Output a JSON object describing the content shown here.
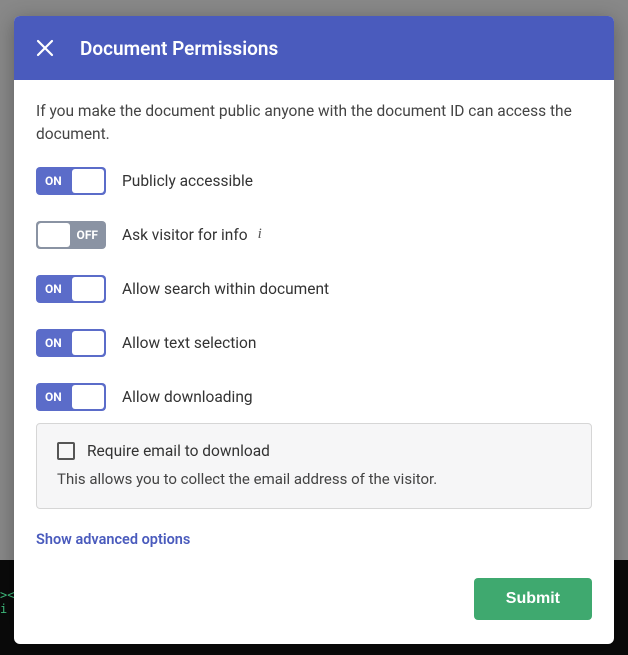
{
  "header": {
    "title": "Document Permissions"
  },
  "intro": "If you make the document public anyone with the document ID can access the document.",
  "toggles": {
    "on_text": "ON",
    "off_text": "OFF",
    "public": {
      "state": "on",
      "label": "Publicly accessible"
    },
    "visitor_info": {
      "state": "off",
      "label": "Ask visitor for info"
    },
    "search": {
      "state": "on",
      "label": "Allow search within document"
    },
    "text_select": {
      "state": "on",
      "label": "Allow text selection"
    },
    "download": {
      "state": "on",
      "label": "Allow downloading"
    }
  },
  "download_box": {
    "checkbox_label": "Require email to download",
    "checked": false,
    "helper": "This allows you to collect the email address of the visitor."
  },
  "advanced_link": "Show advanced options",
  "submit_label": "Submit",
  "colors": {
    "primary": "#4a5bbd",
    "toggle_on": "#5b6cc9",
    "toggle_off": "#8a93a3",
    "submit": "#3fa96f"
  }
}
